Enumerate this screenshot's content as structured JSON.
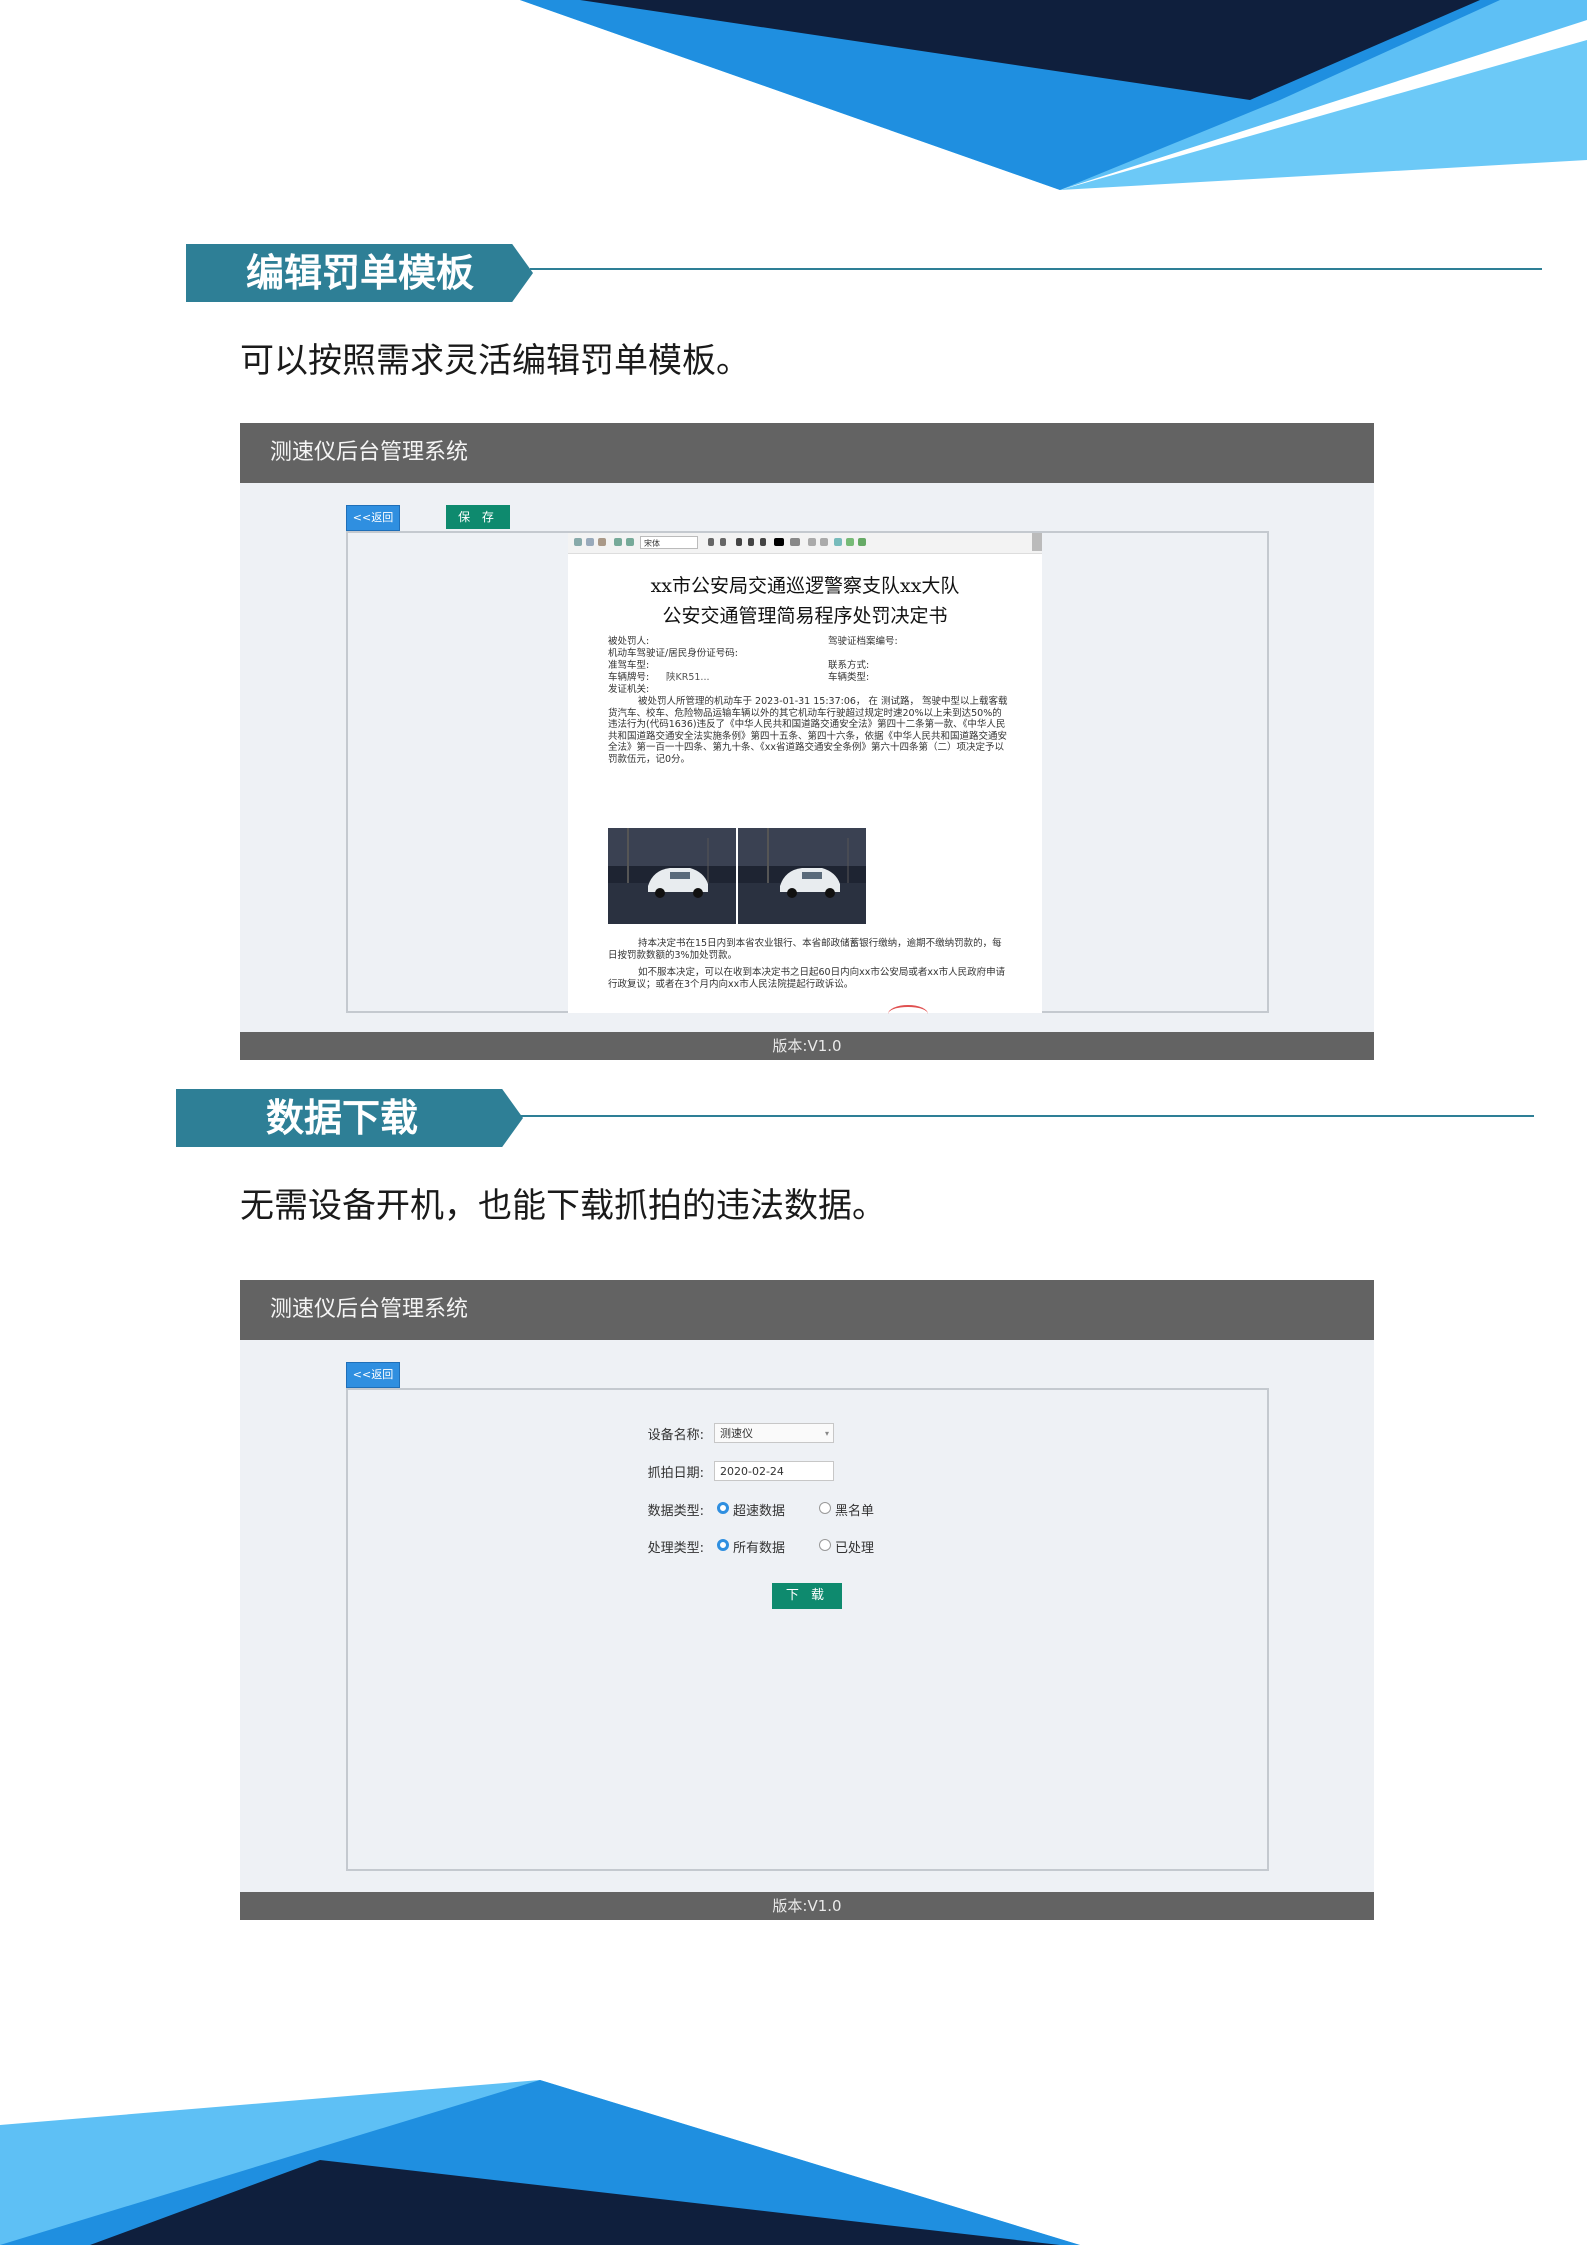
{
  "section1": {
    "title": "编辑罚单模板",
    "description": "可以按照需求灵活编辑罚单模板。"
  },
  "section2": {
    "title": "数据下载",
    "description": "无需设备开机，也能下载抓拍的违法数据。"
  },
  "editor_window": {
    "app_title": "测速仪后台管理系统",
    "back_label": "<<返回",
    "save_label": "保 存",
    "font_select": "宋体",
    "version": "版本:V1.0",
    "document": {
      "title_line1": "xx市公安局交通巡逻警察支队xx大队",
      "title_line2": "公安交通管理简易程序处罚决定书",
      "field_offender": "被处罚人:",
      "field_license_file": "驾驶证档案编号:",
      "field_id_number": "机动车驾驶证/居民身份证号码:",
      "field_license_class": "准驾车型:",
      "field_contact": "联系方式:",
      "field_plate": "车辆牌号:",
      "plate_value": "陕KR51...",
      "field_vehicle_type": "车辆类型:",
      "field_issuer": "发证机关:",
      "body": "被处罚人所管理的机动车于 2023-01-31 15:37:06， 在 测试路， 驾驶中型以上载客载货汽车、校车、危险物品运输车辆以外的其它机动车行驶超过规定时速20%以上未到达50%的违法行为(代码1636)违反了《中华人民共和国道路交通安全法》第四十二条第一款、《中华人民共和国道路交通安全法实施条例》第四十五条、第四十六条，依据《中华人民共和国道路交通安全法》第一百一十四条、第九十条、《xx省道路交通安全条例》第六十四条第（二）项决定予以罚款伍元，记0分。",
      "payment": "持本决定书在15日内到本省农业银行、本省邮政储蓄银行缴纳，逾期不缴纳罚款的，每日按罚款数额的3%加处罚款。",
      "appeal": "如不服本决定，可以在收到本决定书之日起60日内向xx市公安局或者xx市人民政府申请行政复议；或者在3个月内向xx市人民法院提起行政诉讼。"
    }
  },
  "download_window": {
    "app_title": "测速仪后台管理系统",
    "back_label": "<<返回",
    "device_label": "设备名称:",
    "device_value": "测速仪",
    "date_label": "抓拍日期:",
    "date_value": "2020-02-24",
    "data_type_label": "数据类型:",
    "data_type_options": [
      "超速数据",
      "黑名单"
    ],
    "data_type_selected": 0,
    "process_type_label": "处理类型:",
    "process_type_options": [
      "所有数据",
      "已处理"
    ],
    "process_type_selected": 0,
    "download_label": "下 载",
    "version": "版本:V1.0"
  },
  "colors": {
    "accent_teal": "#2e7f96",
    "button_blue": "#2f8fe0",
    "button_green": "#0e8a6e",
    "header_gray": "#636363",
    "deco_navy": "#0f1f3d",
    "deco_blue": "#1f8fe0",
    "deco_light": "#5ec0f5"
  }
}
